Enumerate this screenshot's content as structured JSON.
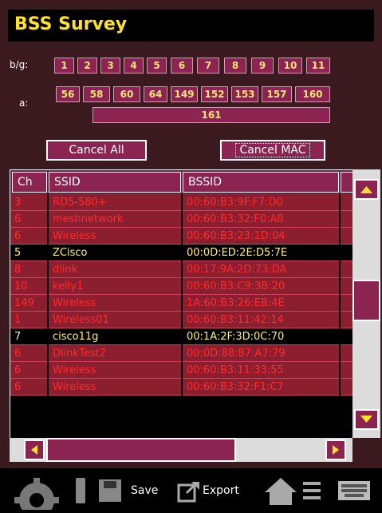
{
  "title": "BSS Survey",
  "bg_label": "b/g:",
  "a_label": "a:",
  "bg_channels": [
    "1",
    "2",
    "3",
    "4",
    "5",
    "6",
    "7",
    "8",
    "9",
    "10",
    "11"
  ],
  "a_channels_row1": [
    "56",
    "58",
    "60",
    "64",
    "149",
    "152",
    "153",
    "157",
    "160"
  ],
  "a_channel_wide": "161",
  "buttons": {
    "cancel_all": "Cancel All",
    "cancel_mac": "Cancel MAC"
  },
  "table": {
    "headers": [
      "Ch",
      "SSID",
      "BSSID"
    ],
    "rows": [
      {
        "ch": "3",
        "ssid": "RD5-580+",
        "bssid": "00:60:B3:9F:F7:D0",
        "style": "red"
      },
      {
        "ch": "6",
        "ssid": "meshnetwork",
        "bssid": "00:60:B3:32:F0:A8",
        "style": "red"
      },
      {
        "ch": "6",
        "ssid": "Wireless",
        "bssid": "00:60:B3:23:1D:04",
        "style": "red"
      },
      {
        "ch": "5",
        "ssid": "ZCisco",
        "bssid": "00:0D:ED:2E:D5:7E",
        "style": "yel"
      },
      {
        "ch": "8",
        "ssid": "dlink",
        "bssid": "00:17:9A:2D:73:DA",
        "style": "red"
      },
      {
        "ch": "10",
        "ssid": "kelly1",
        "bssid": "00:60:B3:C9:3B:20",
        "style": "red"
      },
      {
        "ch": "149",
        "ssid": "Wireless",
        "bssid": "1A:60:B3:26:EB:4E",
        "style": "red"
      },
      {
        "ch": "1",
        "ssid": "Wireless01",
        "bssid": "00:60:B3:11:42:14",
        "style": "red"
      },
      {
        "ch": "7",
        "ssid": "cisco11g",
        "bssid": "00:1A:2F:3D:0C:70",
        "style": "yel"
      },
      {
        "ch": "6",
        "ssid": "DlinkTest2",
        "bssid": "00:0D:88:87:A7:79",
        "style": "red"
      },
      {
        "ch": "6",
        "ssid": "Wireless",
        "bssid": "00:60:B3:11:33:55",
        "style": "red"
      },
      {
        "ch": "6",
        "ssid": "Wireless",
        "bssid": "00:60:B3:32:F1:C7",
        "style": "red"
      }
    ]
  },
  "toolbar": {
    "save_label": "Save",
    "export_label": "Export"
  },
  "colors": {
    "accent": "#8b2450",
    "title": "#ffe12a",
    "row_red_text": "#ff2a2a",
    "row_yellow_text": "#ffef6a"
  }
}
